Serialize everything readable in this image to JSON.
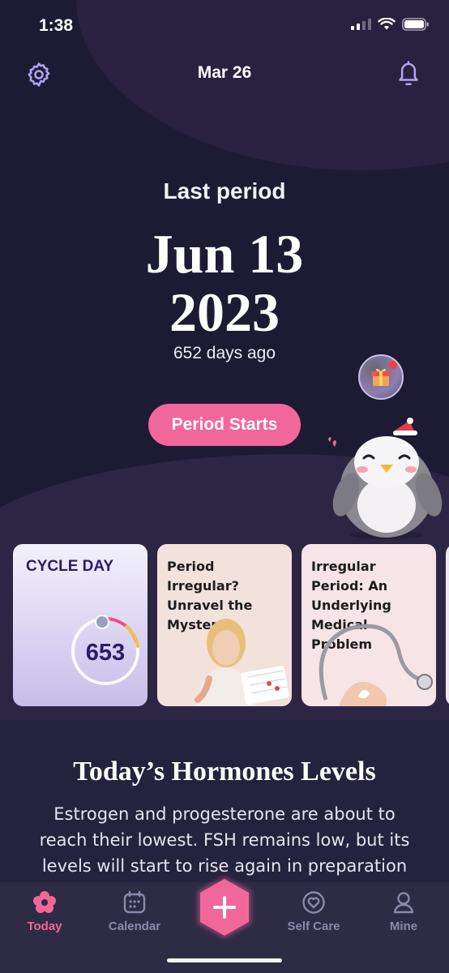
{
  "status_bar": {
    "time": "1:38"
  },
  "header": {
    "date": "Mar 26",
    "settings_icon": "gear-icon",
    "notifications_icon": "bell-icon"
  },
  "hero": {
    "label": "Last period",
    "date": "Jun 13",
    "year": "2023",
    "ago": "652 days ago",
    "button_label": "Period Starts"
  },
  "cards": {
    "cycle": {
      "label": "CYCLE DAY",
      "value": "653"
    },
    "articles": [
      {
        "title": "Period Irregular? Unravel the Mystery!"
      },
      {
        "title": "Irregular Period: An Underlying Medical Problem"
      }
    ]
  },
  "hormones": {
    "title": "Today’s Hormones Levels",
    "text": "Estrogen and progesterone are about to reach their lowest. FSH remains low, but its levels will start to rise again in preparation"
  },
  "tabs": [
    {
      "label": "Today",
      "icon": "flower-icon",
      "active": true
    },
    {
      "label": "Calendar",
      "icon": "calendar-icon",
      "active": false
    },
    {
      "label": "Self Care",
      "icon": "heart-icon",
      "active": false
    },
    {
      "label": "Mine",
      "icon": "person-icon",
      "active": false
    }
  ],
  "colors": {
    "background": "#1d1b33",
    "accent_pink": "#f2679a",
    "cycle_text": "#2c1a6b",
    "tab_inactive": "#8c88a8"
  }
}
